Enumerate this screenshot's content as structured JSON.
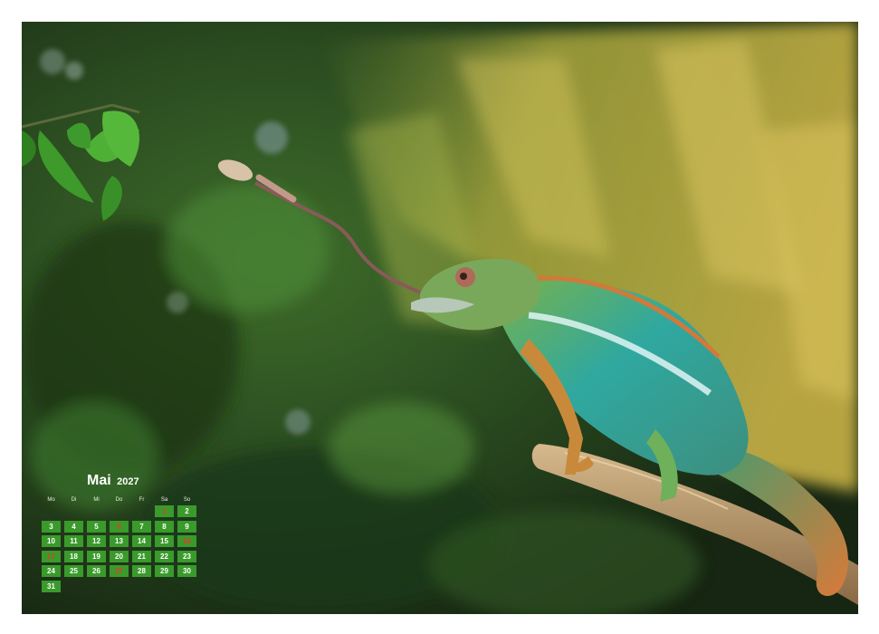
{
  "calendar": {
    "month": "Mai",
    "year": "2027",
    "weekdays": [
      "Mo",
      "Di",
      "Mi",
      "Do",
      "Fr",
      "Sa",
      "So"
    ],
    "days": [
      {
        "label": "1",
        "col": 5,
        "row": 0,
        "holiday": true
      },
      {
        "label": "2",
        "col": 6,
        "row": 0,
        "holiday": false
      },
      {
        "label": "3",
        "col": 0,
        "row": 1,
        "holiday": false
      },
      {
        "label": "4",
        "col": 1,
        "row": 1,
        "holiday": false
      },
      {
        "label": "5",
        "col": 2,
        "row": 1,
        "holiday": false
      },
      {
        "label": "6",
        "col": 3,
        "row": 1,
        "holiday": true
      },
      {
        "label": "7",
        "col": 4,
        "row": 1,
        "holiday": false
      },
      {
        "label": "8",
        "col": 5,
        "row": 1,
        "holiday": false
      },
      {
        "label": "9",
        "col": 6,
        "row": 1,
        "holiday": false
      },
      {
        "label": "10",
        "col": 0,
        "row": 2,
        "holiday": false
      },
      {
        "label": "11",
        "col": 1,
        "row": 2,
        "holiday": false
      },
      {
        "label": "12",
        "col": 2,
        "row": 2,
        "holiday": false
      },
      {
        "label": "13",
        "col": 3,
        "row": 2,
        "holiday": false
      },
      {
        "label": "14",
        "col": 4,
        "row": 2,
        "holiday": false
      },
      {
        "label": "15",
        "col": 5,
        "row": 2,
        "holiday": false
      },
      {
        "label": "16",
        "col": 6,
        "row": 2,
        "holiday": true
      },
      {
        "label": "17",
        "col": 0,
        "row": 3,
        "holiday": true
      },
      {
        "label": "18",
        "col": 1,
        "row": 3,
        "holiday": false
      },
      {
        "label": "19",
        "col": 2,
        "row": 3,
        "holiday": false
      },
      {
        "label": "20",
        "col": 3,
        "row": 3,
        "holiday": false
      },
      {
        "label": "21",
        "col": 4,
        "row": 3,
        "holiday": false
      },
      {
        "label": "22",
        "col": 5,
        "row": 3,
        "holiday": false
      },
      {
        "label": "23",
        "col": 6,
        "row": 3,
        "holiday": false
      },
      {
        "label": "24",
        "col": 0,
        "row": 4,
        "holiday": false
      },
      {
        "label": "25",
        "col": 1,
        "row": 4,
        "holiday": false
      },
      {
        "label": "26",
        "col": 2,
        "row": 4,
        "holiday": false
      },
      {
        "label": "27",
        "col": 3,
        "row": 4,
        "holiday": true
      },
      {
        "label": "28",
        "col": 4,
        "row": 4,
        "holiday": false
      },
      {
        "label": "29",
        "col": 5,
        "row": 4,
        "holiday": false
      },
      {
        "label": "30",
        "col": 6,
        "row": 4,
        "holiday": false
      },
      {
        "label": "31",
        "col": 0,
        "row": 5,
        "holiday": false
      }
    ]
  },
  "colors": {
    "day_cell": "#3a9a2c",
    "holiday_text": "#e53a2a",
    "chameleon_body": "#2fa8a0",
    "chameleon_stripe": "#dff4f4",
    "background_green": "#2e4a22"
  },
  "icons": [
    "binding-hole-icon"
  ]
}
